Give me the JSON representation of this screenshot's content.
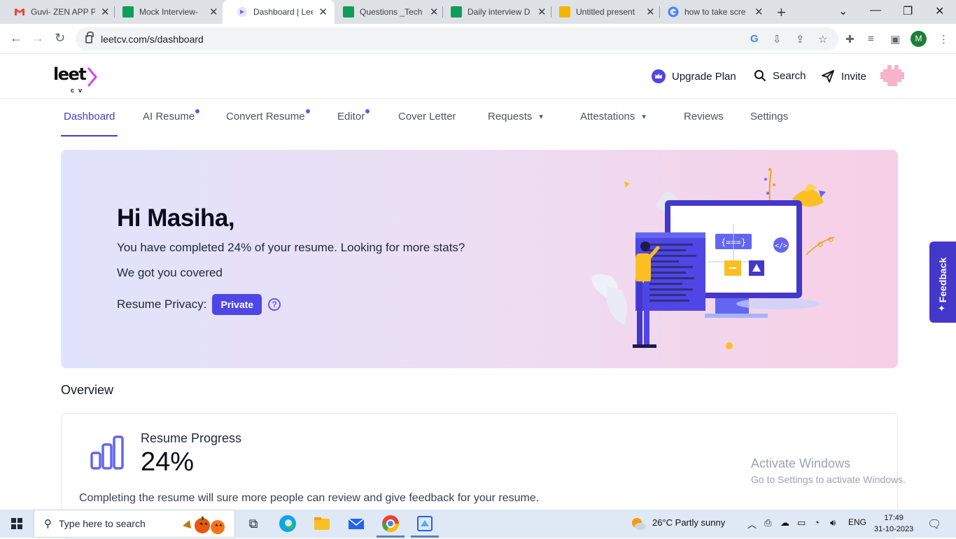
{
  "browser": {
    "tabs": [
      {
        "title": "Guvi- ZEN APP P",
        "favicon": "gmail-icon",
        "color": "#ea4335"
      },
      {
        "title": "Mock Interview-",
        "favicon": "sheets-icon",
        "color": "#0f9d58"
      },
      {
        "title": "Dashboard | Leet",
        "favicon": "leetcv-icon",
        "color": "#6366f1"
      },
      {
        "title": "Questions _Tech",
        "favicon": "sheets-icon",
        "color": "#0f9d58"
      },
      {
        "title": "Daily interview D",
        "favicon": "sheets-icon",
        "color": "#0f9d58"
      },
      {
        "title": "Untitled present",
        "favicon": "slides-icon",
        "color": "#f4b400"
      },
      {
        "title": "how to take scre",
        "favicon": "google-icon",
        "color": "#4285f4"
      }
    ],
    "url": "leetcv.com/s/dashboard",
    "profile_initial": "M"
  },
  "header": {
    "logo_text": "leet",
    "logo_sub": "cv",
    "upgrade": "Upgrade Plan",
    "search": "Search",
    "invite": "Invite"
  },
  "nav": {
    "items": [
      "Dashboard",
      "AI Resume",
      "Convert Resume",
      "Editor",
      "Cover Letter",
      "Requests",
      "Attestations",
      "Reviews",
      "Settings"
    ]
  },
  "hero": {
    "greeting": "Hi Masiha,",
    "line1": "You have completed 24% of your resume. Looking for more stats?",
    "line2": "We got you covered",
    "privacy_label": "Resume Privacy:",
    "privacy_value": "Private",
    "help": "?"
  },
  "overview": {
    "title": "Overview",
    "progress_label": "Resume Progress",
    "progress_value": "24%",
    "progress_fraction": 0.24,
    "description": "Completing the resume will sure more people can review and give feedback for your resume."
  },
  "feedback": "Feedback",
  "watermark": {
    "title": "Activate Windows",
    "subtitle": "Go to Settings to activate Windows."
  },
  "taskbar": {
    "search_placeholder": "Type here to search",
    "weather": "26°C  Partly sunny",
    "lang": "ENG",
    "time": "17:49",
    "date": "31-10-2023"
  },
  "colors": {
    "accent": "#4f46e5",
    "active_nav": "#3f3fd6"
  }
}
